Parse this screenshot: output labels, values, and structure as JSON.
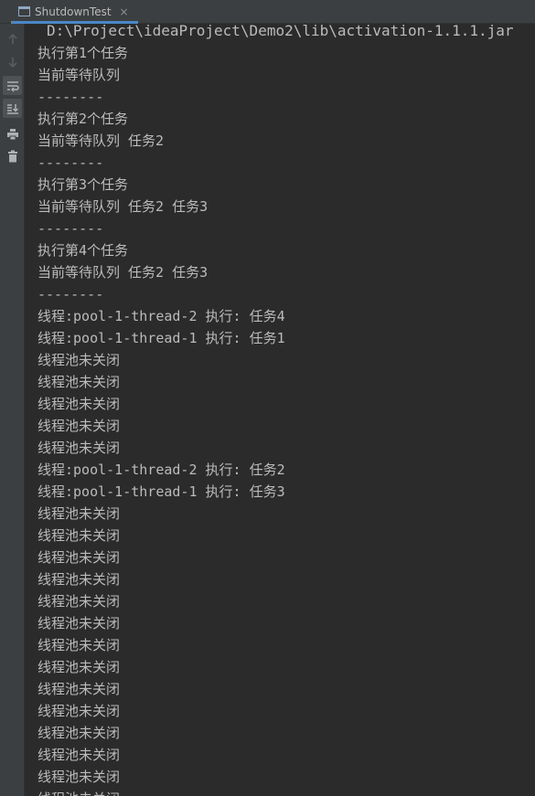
{
  "tab": {
    "title": "ShutdownTest",
    "icon": "console-icon",
    "close": "×"
  },
  "toolbar": {
    "buttons": [
      {
        "name": "up-arrow-icon",
        "interactable": true
      },
      {
        "name": "down-arrow-icon",
        "interactable": true
      },
      {
        "name": "soft-wrap-icon",
        "active": true
      },
      {
        "name": "scroll-to-end-icon",
        "active": true
      },
      {
        "name": "print-icon"
      },
      {
        "name": "trash-icon"
      }
    ]
  },
  "console": {
    "command": "D:\\Project\\ideaProject\\Demo2\\lib\\activation-1.1.1.jar",
    "lines": [
      "执行第1个任务",
      "当前等待队列",
      "--------",
      "执行第2个任务",
      "当前等待队列 任务2",
      "--------",
      "执行第3个任务",
      "当前等待队列 任务2 任务3",
      "--------",
      "执行第4个任务",
      "当前等待队列 任务2 任务3",
      "--------",
      "线程:pool-1-thread-2 执行: 任务4",
      "线程:pool-1-thread-1 执行: 任务1",
      "线程池未关闭",
      "线程池未关闭",
      "线程池未关闭",
      "线程池未关闭",
      "线程池未关闭",
      "线程:pool-1-thread-2 执行: 任务2",
      "线程:pool-1-thread-1 执行: 任务3",
      "线程池未关闭",
      "线程池未关闭",
      "线程池未关闭",
      "线程池未关闭",
      "线程池未关闭",
      "线程池未关闭",
      "线程池未关闭",
      "线程池未关闭",
      "线程池未关闭",
      "线程池未关闭",
      "线程池未关闭",
      "线程池未关闭",
      "线程池未关闭",
      "线程池未关闭"
    ]
  },
  "colors": {
    "background": "#2b2b2b",
    "panel": "#3c3f41",
    "text": "#bbbbbb",
    "tab_accent": "#4a88c7"
  }
}
